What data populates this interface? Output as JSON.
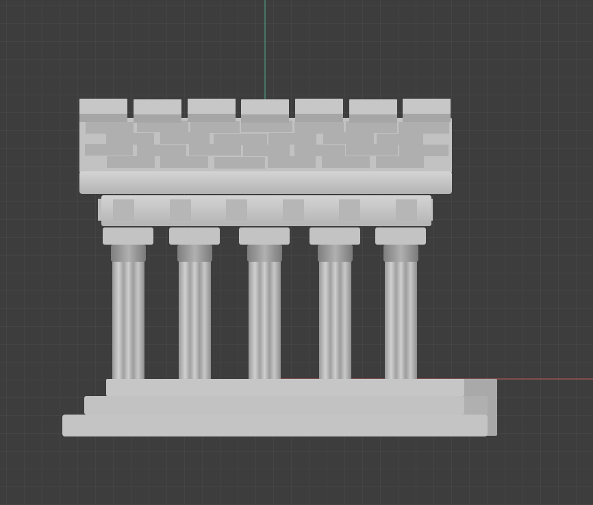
{
  "viewport": {
    "background": "#3d3d3d",
    "grid_color": "#4a4a4a",
    "x_axis_color": "#c05a5a",
    "y_axis_color": "#4fb08a",
    "model_color": "#c4c4c4",
    "model_shadow_color": "#a8a8a8"
  },
  "model": {
    "columns": 5,
    "top_blocks": 7,
    "metopes": 6,
    "steps": 3
  }
}
